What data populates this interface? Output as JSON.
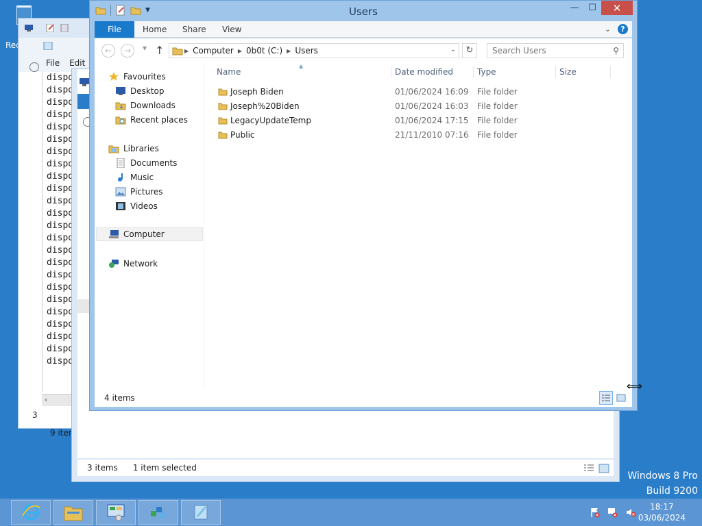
{
  "desktop": {
    "recycle_label_fragment": "Rec",
    "watermark_line1": "Windows 8 Pro",
    "watermark_line2": "Build 9200"
  },
  "back_window": {
    "menu": [
      "File",
      "Edit"
    ],
    "rows": [
      "dispo",
      "dispo",
      "dispo",
      "dispo",
      "dispo",
      "dispo",
      "dispo",
      "dispo",
      "dispo",
      "dispo",
      "dispo",
      "dispo",
      "dispo",
      "dispo",
      "dispo",
      "dispo",
      "dispo",
      "dispo",
      "dispo",
      "dispo",
      "dispo",
      "dispo",
      "dispo",
      "dispo"
    ],
    "status": "9 item",
    "fragment_3": "3"
  },
  "middle_window": {
    "status_items": "3 items",
    "status_selected": "1 item selected"
  },
  "explorer": {
    "title": "Users",
    "tabs": {
      "file": "File",
      "home": "Home",
      "share": "Share",
      "view": "View"
    },
    "address": {
      "crumbs": [
        "Computer",
        "0b0t (C:)",
        "Users"
      ]
    },
    "search_placeholder": "Search Users",
    "nav": {
      "favourites": "Favourites",
      "desktop": "Desktop",
      "downloads": "Downloads",
      "recent": "Recent places",
      "libraries": "Libraries",
      "documents": "Documents",
      "music": "Music",
      "pictures": "Pictures",
      "videos": "Videos",
      "computer": "Computer",
      "network": "Network"
    },
    "columns": {
      "name": "Name",
      "date": "Date modified",
      "type": "Type",
      "size": "Size"
    },
    "files": [
      {
        "name": "Joseph Biden",
        "date": "01/06/2024 16:09",
        "type": "File folder"
      },
      {
        "name": "Joseph%20Biden",
        "date": "01/06/2024 16:03",
        "type": "File folder"
      },
      {
        "name": "LegacyUpdateTemp",
        "date": "01/06/2024 17:15",
        "type": "File folder"
      },
      {
        "name": "Public",
        "date": "21/11/2010 07:16",
        "type": "File folder"
      }
    ],
    "status": "4 items"
  },
  "taskbar": {
    "time": "18:17",
    "date": "03/06/2024"
  },
  "colors": {
    "desktop": "#2a7dc9",
    "file_tab": "#1979ca",
    "close_button": "#c7504a",
    "folder": "#e8c05a",
    "taskbar": "#5b95d3"
  }
}
